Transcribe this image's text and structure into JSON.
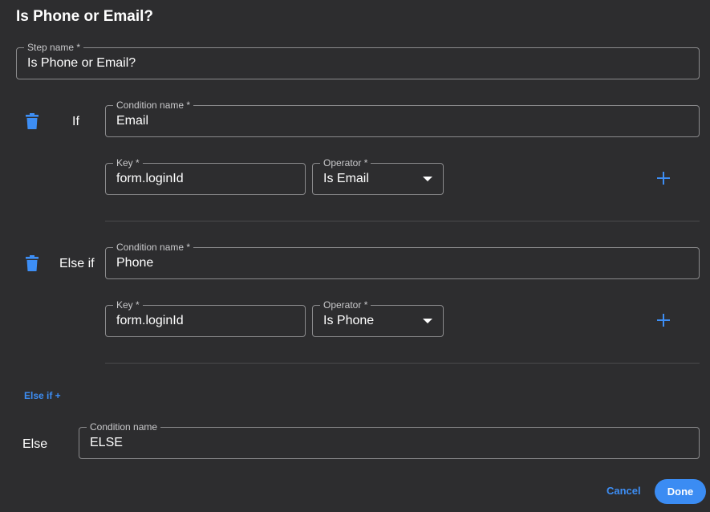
{
  "dialog": {
    "title": "Is Phone or Email?"
  },
  "step_name": {
    "label": "Step name *",
    "value": "Is Phone or Email?"
  },
  "conditions": [
    {
      "row_label": "If",
      "condition_name_label": "Condition name *",
      "condition_name_value": "Email",
      "key_label": "Key *",
      "key_value": "form.loginId",
      "operator_label": "Operator *",
      "operator_value": "Is Email",
      "delete_icon": "trash-icon",
      "add_icon": "plus-icon"
    },
    {
      "row_label": "Else if",
      "condition_name_label": "Condition name *",
      "condition_name_value": "Phone",
      "key_label": "Key *",
      "key_value": "form.loginId",
      "operator_label": "Operator *",
      "operator_value": "Is Phone",
      "delete_icon": "trash-icon",
      "add_icon": "plus-icon"
    }
  ],
  "add_else_if_label": "Else if +",
  "else_branch": {
    "row_label": "Else",
    "condition_name_label": "Condition name",
    "condition_name_value": "ELSE"
  },
  "actions": {
    "cancel_label": "Cancel",
    "done_label": "Done"
  },
  "colors": {
    "background": "#2d2d2f",
    "accent": "#3d8ef5",
    "border": "#8a8a8c"
  }
}
